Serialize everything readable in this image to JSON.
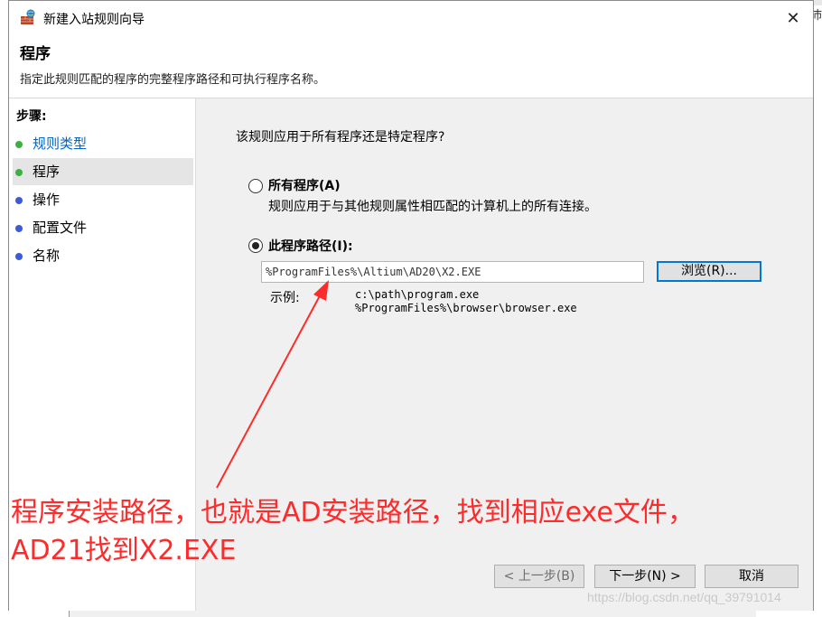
{
  "window": {
    "title": "新建入站规则向导",
    "close_glyph": "✕"
  },
  "header": {
    "title": "程序",
    "description": "指定此规则匹配的程序的完整程序路径和可执行程序名称。"
  },
  "steps": {
    "heading": "步骤:",
    "items": [
      {
        "label": "规则类型",
        "dot_color": "#3cb043"
      },
      {
        "label": "程序",
        "dot_color": "#3cb043"
      },
      {
        "label": "操作",
        "dot_color": "#3d5bd9"
      },
      {
        "label": "配置文件",
        "dot_color": "#3d5bd9"
      },
      {
        "label": "名称",
        "dot_color": "#3d5bd9"
      }
    ]
  },
  "content": {
    "question": "该规则应用于所有程序还是特定程序?",
    "option_all": {
      "label": "所有程序(A)",
      "description": "规则应用于与其他规则属性相匹配的计算机上的所有连接。",
      "checked": false
    },
    "option_path": {
      "label": "此程序路径(I):",
      "checked": true
    },
    "path_value": "%ProgramFiles%\\Altium\\AD20\\X2.EXE",
    "browse_label": "浏览(R)...",
    "example_label": "示例:",
    "example_lines": [
      "c:\\path\\program.exe",
      "%ProgramFiles%\\browser\\browser.exe"
    ]
  },
  "footer": {
    "back_label": "< 上一步(B)",
    "next_label": "下一步(N) >",
    "cancel_label": "取消"
  },
  "annotation": {
    "line1": "程序安装路径，也就是AD安装路径，找到相应exe文件，",
    "line2": "AD21找到X2.EXE",
    "color": "#ff2a2a"
  },
  "background": {
    "right_edge_text": "沛",
    "watermark": "https://blog.csdn.net/qq_39791014"
  }
}
